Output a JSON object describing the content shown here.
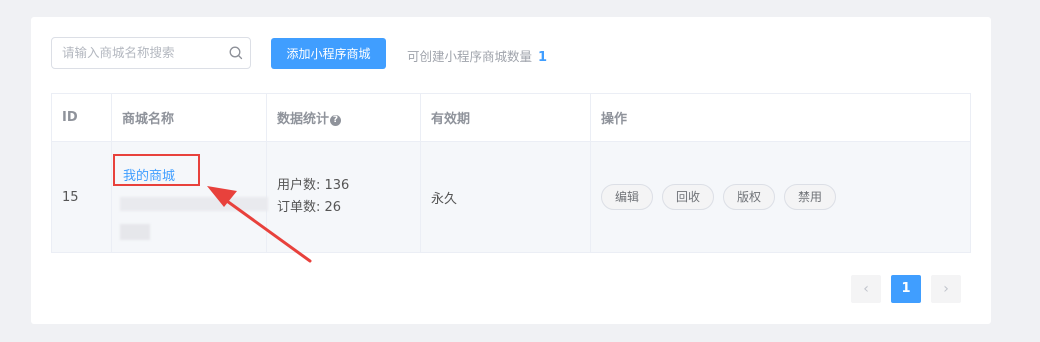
{
  "search": {
    "placeholder": "请输入商城名称搜索",
    "value": ""
  },
  "toolbar": {
    "add_label": "添加小程序商城",
    "quota_label": "可创建小程序商城数量",
    "quota_value": "1"
  },
  "table": {
    "headers": [
      "ID",
      "商城名称",
      "数据统计",
      "有效期",
      "操作"
    ],
    "rows": [
      {
        "id": "15",
        "name": "我的商城",
        "users": "用户数: 136",
        "orders": "订单数: 26",
        "validity": "永久",
        "actions": [
          "编辑",
          "回收",
          "版权",
          "禁用"
        ]
      }
    ]
  },
  "pagination": {
    "prev": "‹",
    "current": "1",
    "next": "›"
  },
  "colors": {
    "accent": "#409eff",
    "annotation": "#e8413c"
  }
}
